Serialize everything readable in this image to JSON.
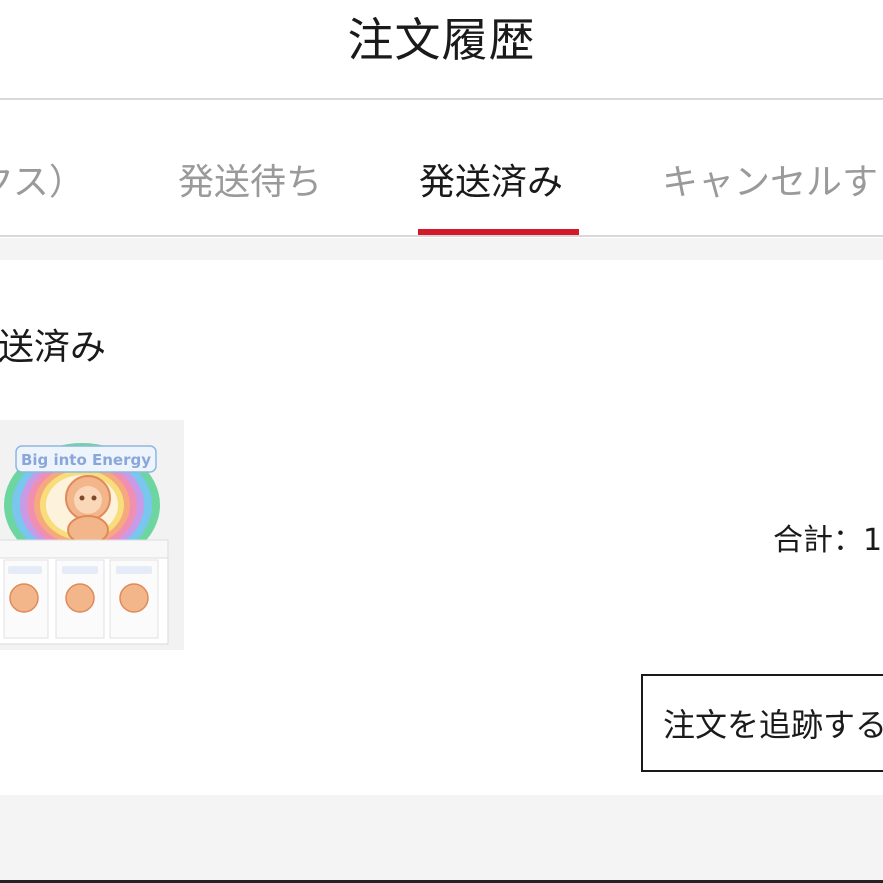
{
  "header": {
    "title": "注文履歴"
  },
  "tabs": [
    {
      "label": "クス）",
      "active": false
    },
    {
      "label": "発送待ち",
      "active": false
    },
    {
      "label": "発送済み",
      "active": true
    },
    {
      "label": "キャンセルす",
      "active": false
    }
  ],
  "order": {
    "status": "送済み",
    "product_image_text": "Big into Energy",
    "total_label": "合計：1",
    "track_button_label": "注文を追跡する"
  },
  "colors": {
    "accent": "#d4192b",
    "tab_inactive": "#9a9a9a",
    "text": "#1a1a1a",
    "section_bg": "#f4f4f4"
  }
}
